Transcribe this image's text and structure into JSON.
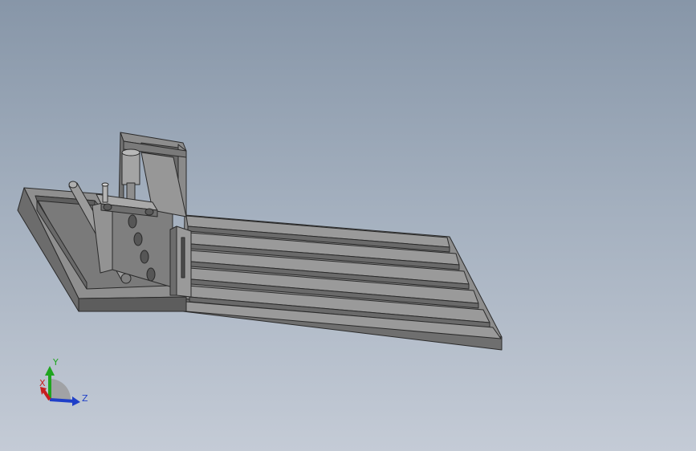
{
  "viewport": {
    "background_top": "#8796a8",
    "background_bottom": "#c4cbd6"
  },
  "model": {
    "body_color": "#8a8a8a",
    "edge_color": "#2a2a2a"
  },
  "triad": {
    "x_label": "X",
    "y_label": "Y",
    "z_label": "Z",
    "x_color": "#c81e1e",
    "y_color": "#1fa51f",
    "z_color": "#1f3fc8"
  }
}
